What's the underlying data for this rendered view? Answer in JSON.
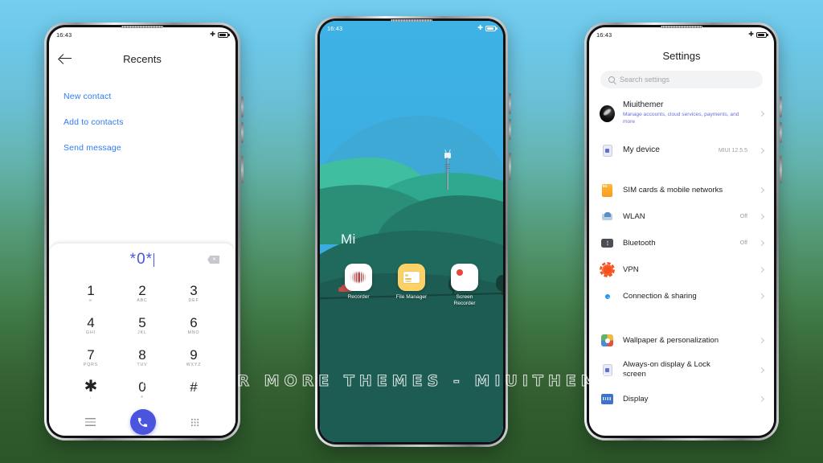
{
  "watermark": "VISIT FOR MORE THEMES - MIUITHEMER.COM",
  "background": {
    "top_color": "#74cdef",
    "bottom_color": "#2b5628"
  },
  "phones": {
    "left": {
      "status_bar": {
        "time": "16:43",
        "airplane_icon": "airplane-mode-icon",
        "battery_icon": "battery-icon"
      },
      "appbar": {
        "back_icon": "back-arrow-icon",
        "title": "Recents"
      },
      "links": [
        {
          "label": "New contact"
        },
        {
          "label": "Add to contacts"
        },
        {
          "label": "Send message"
        }
      ],
      "dialer": {
        "number": "*0*",
        "delete_icon": "backspace-icon",
        "accent_color": "#4a54dd",
        "keys": [
          {
            "num": "1",
            "sub": "∞"
          },
          {
            "num": "2",
            "sub": "ABC"
          },
          {
            "num": "3",
            "sub": "DEF"
          },
          {
            "num": "4",
            "sub": "GHI"
          },
          {
            "num": "5",
            "sub": "JKL"
          },
          {
            "num": "6",
            "sub": "MNO"
          },
          {
            "num": "7",
            "sub": "PQRS"
          },
          {
            "num": "8",
            "sub": "TUV"
          },
          {
            "num": "9",
            "sub": "WXYZ"
          },
          {
            "num": "✱",
            "sub": ","
          },
          {
            "num": "0",
            "sub": "+"
          },
          {
            "num": "#",
            "sub": ""
          }
        ],
        "bottom": {
          "list_icon": "call-log-list-icon",
          "call_icon": "phone-call-icon",
          "keypad_icon": "keypad-grid-icon"
        }
      }
    },
    "middle": {
      "status_bar": {
        "time": "16:43",
        "airplane_icon": "airplane-mode-icon",
        "battery_icon": "battery-icon"
      },
      "wallpaper_label": "Mi",
      "wallpaper": {
        "sky_color": "#3fb2e5",
        "hill_colors": [
          "#3fa9d6",
          "#3fbfa0",
          "#2fa890",
          "#2b8f78",
          "#237a68",
          "#1f6a5c",
          "#1d5c52"
        ],
        "elements": [
          "cell-tower",
          "road",
          "red-car",
          "trees"
        ]
      },
      "apps": [
        {
          "label": "Recorder",
          "icon": "recorder-icon"
        },
        {
          "label": "File Manager",
          "icon": "file-manager-icon"
        },
        {
          "label": "Screen Recorder",
          "icon": "screen-recorder-icon"
        }
      ]
    },
    "right": {
      "status_bar": {
        "time": "16:43",
        "airplane_icon": "airplane-mode-icon",
        "battery_icon": "battery-icon"
      },
      "title": "Settings",
      "search": {
        "placeholder": "Search settings",
        "icon": "search-icon"
      },
      "account": {
        "name": "Miuithemer",
        "subtitle": "Manage accounts, cloud services, payments, and more",
        "avatar": "user-avatar"
      },
      "device": {
        "label": "My device",
        "value": "MIUI 12.5.5",
        "icon": "phone-device-icon"
      },
      "items": [
        {
          "label": "SIM cards & mobile networks",
          "value": "",
          "icon": "sim-card-icon"
        },
        {
          "label": "WLAN",
          "value": "Off",
          "icon": "wlan-icon"
        },
        {
          "label": "Bluetooth",
          "value": "Off",
          "icon": "bluetooth-icon"
        },
        {
          "label": "VPN",
          "value": "",
          "icon": "vpn-icon"
        },
        {
          "label": "Connection & sharing",
          "value": "",
          "icon": "connection-sharing-icon"
        }
      ],
      "items2": [
        {
          "label": "Wallpaper & personalization",
          "value": "",
          "icon": "wallpaper-icon"
        },
        {
          "label": "Always-on display & Lock screen",
          "value": "",
          "icon": "always-on-display-icon"
        },
        {
          "label": "Display",
          "value": "",
          "icon": "display-icon"
        }
      ]
    }
  }
}
